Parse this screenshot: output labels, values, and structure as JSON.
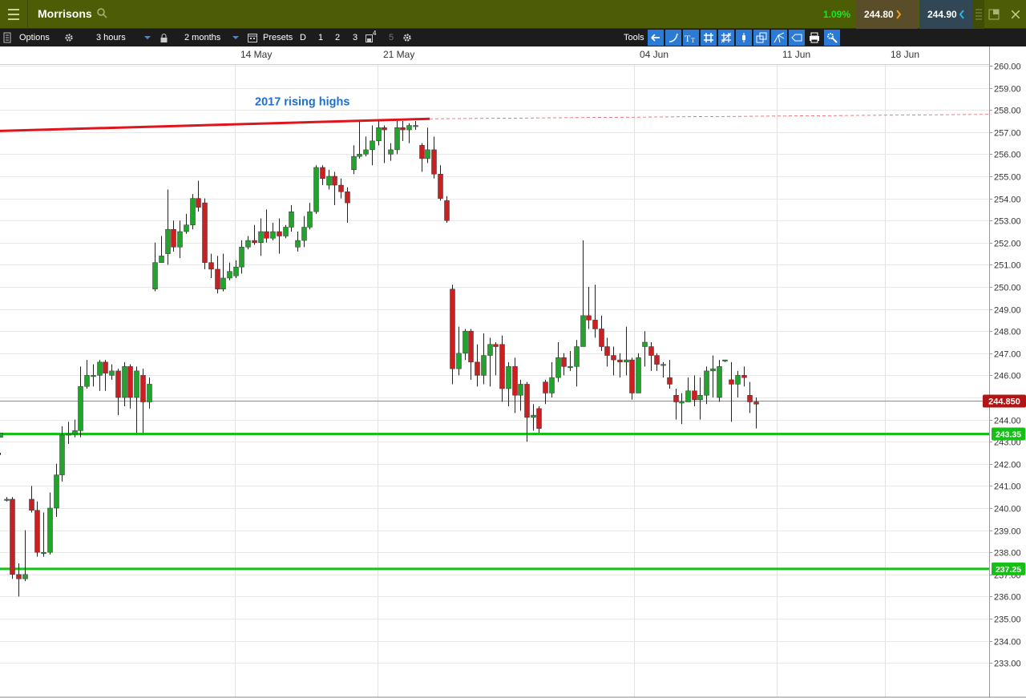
{
  "header": {
    "instrument": "Morrisons",
    "change_pct": "1.09%",
    "sell_price": "244.80",
    "buy_price": "244.90"
  },
  "toolbar": {
    "options_label": "Options",
    "interval": "3 hours",
    "range": "2 months",
    "presets_label": "Presets",
    "preset_items": [
      "D",
      "1",
      "2",
      "3",
      "4",
      "5"
    ],
    "tools_label": "Tools"
  },
  "colors": {
    "up": "#22a32b",
    "down": "#cc1f1f",
    "resistance": "#e0141c",
    "support": "#18bf18",
    "annotation": "#1e6fd1"
  },
  "chart_data": {
    "type": "candlestick",
    "x_ticks": [
      "14 May",
      "21 May",
      "04 Jun",
      "11 Jun",
      "18 Jun"
    ],
    "ylim": [
      232.5,
      260.3
    ],
    "y_ticks": [
      "260.00",
      "259.00",
      "258.00",
      "257.00",
      "256.00",
      "255.00",
      "254.00",
      "253.00",
      "252.00",
      "251.00",
      "250.00",
      "249.00",
      "248.00",
      "247.00",
      "246.00",
      "245.00",
      "244.00",
      "243.00",
      "242.00",
      "241.00",
      "240.00",
      "239.00",
      "238.00",
      "237.00",
      "236.00",
      "235.00",
      "234.00",
      "233.00"
    ],
    "current_price": "244.850",
    "support_levels": [
      {
        "label": "243.35",
        "value": 243.35
      },
      {
        "label": "237.25",
        "value": 237.25
      }
    ],
    "resistance_annotation": "2017 rising highs",
    "resistance_line": {
      "from": 257.05,
      "to": 257.6
    },
    "dashed_level": 257.8,
    "candles": [
      [
        243.2,
        243.4,
        242.5,
        242.4
      ],
      [
        240.4,
        240.4,
        240.5,
        240.3
      ],
      [
        240.4,
        237.0,
        240.5,
        236.8
      ],
      [
        237.0,
        236.8,
        237.5,
        236.0
      ],
      [
        236.8,
        237.0,
        239.0,
        236.7
      ],
      [
        240.4,
        239.9,
        241.0,
        239.8
      ],
      [
        239.9,
        238.0,
        240.3,
        237.8
      ],
      [
        238.0,
        238.0,
        239.8,
        237.8
      ],
      [
        238.0,
        240.0,
        240.7,
        237.9
      ],
      [
        240.0,
        241.5,
        242.0,
        239.6
      ],
      [
        241.5,
        243.3,
        243.7,
        241.2
      ],
      [
        243.3,
        243.35,
        243.9,
        242.9
      ],
      [
        243.35,
        243.5,
        244.0,
        243.2
      ],
      [
        243.5,
        245.5,
        246.4,
        243.2
      ],
      [
        245.5,
        246.0,
        246.7,
        245.4
      ],
      [
        246.0,
        246.0,
        246.5,
        245.5
      ],
      [
        246.0,
        246.6,
        246.7,
        245.3
      ],
      [
        246.6,
        246.1,
        246.7,
        245.3
      ],
      [
        246.0,
        246.2,
        246.5,
        245.8
      ],
      [
        246.2,
        245.0,
        246.3,
        244.2
      ],
      [
        245.0,
        246.4,
        246.6,
        244.6
      ],
      [
        246.4,
        245.0,
        246.5,
        244.5
      ],
      [
        245.0,
        246.2,
        246.4,
        243.4
      ],
      [
        246.0,
        244.8,
        246.3,
        243.4
      ],
      [
        244.8,
        245.6,
        245.9,
        244.5
      ],
      [
        249.9,
        251.1,
        252.0,
        249.8
      ],
      [
        251.1,
        251.4,
        252.3,
        251.3
      ],
      [
        251.5,
        252.6,
        254.4,
        251.0
      ],
      [
        252.6,
        251.8,
        253.0,
        251.6
      ],
      [
        251.8,
        252.5,
        253.0,
        251.3
      ],
      [
        252.5,
        252.8,
        253.3,
        252.4
      ],
      [
        252.8,
        254.0,
        254.2,
        252.6
      ],
      [
        254.0,
        253.6,
        254.8,
        253.4
      ],
      [
        253.8,
        251.1,
        254.0,
        250.8
      ],
      [
        251.1,
        250.8,
        251.5,
        250.4
      ],
      [
        250.8,
        249.9,
        251.4,
        249.7
      ],
      [
        249.9,
        250.4,
        251.5,
        249.8
      ],
      [
        250.4,
        250.7,
        251.1,
        250.3
      ],
      [
        250.5,
        250.9,
        251.2,
        250.4
      ],
      [
        250.9,
        251.8,
        252.1,
        250.6
      ],
      [
        251.8,
        252.1,
        252.3,
        251.7
      ],
      [
        252.1,
        252.0,
        252.8,
        251.9
      ],
      [
        252.0,
        252.5,
        253.1,
        251.4
      ],
      [
        252.5,
        252.2,
        253.5,
        252.0
      ],
      [
        252.2,
        252.5,
        252.9,
        252.1
      ],
      [
        252.5,
        252.3,
        253.1,
        251.5
      ],
      [
        252.3,
        252.7,
        252.8,
        252.2
      ],
      [
        252.7,
        253.4,
        253.7,
        252.5
      ],
      [
        251.8,
        252.1,
        252.5,
        251.6
      ],
      [
        252.1,
        252.7,
        253.2,
        251.8
      ],
      [
        252.7,
        253.4,
        253.8,
        252.6
      ],
      [
        253.4,
        255.4,
        255.5,
        253.3
      ],
      [
        255.4,
        254.9,
        255.5,
        254.6
      ],
      [
        254.6,
        255.0,
        255.3,
        254.4
      ],
      [
        255.0,
        254.6,
        255.2,
        253.7
      ],
      [
        254.6,
        254.3,
        254.9,
        254.0
      ],
      [
        254.3,
        253.8,
        254.5,
        252.9
      ],
      [
        255.3,
        255.9,
        256.4,
        255.1
      ],
      [
        255.9,
        256.0,
        257.5,
        255.8
      ],
      [
        256.0,
        256.2,
        256.8,
        255.9
      ],
      [
        256.2,
        256.6,
        257.3,
        255.5
      ],
      [
        256.6,
        257.2,
        257.5,
        256.4
      ],
      [
        257.2,
        257.1,
        257.3,
        255.6
      ],
      [
        256.0,
        256.2,
        256.5,
        255.7
      ],
      [
        256.2,
        257.2,
        257.5,
        256.0
      ],
      [
        257.2,
        257.1,
        257.5,
        256.6
      ],
      [
        257.1,
        257.3,
        257.4,
        256.5
      ],
      [
        257.3,
        257.3,
        257.5,
        257.1
      ],
      [
        256.4,
        255.8,
        256.5,
        255.2
      ],
      [
        255.8,
        256.2,
        257.2,
        255.6
      ],
      [
        256.2,
        255.1,
        256.8,
        254.9
      ],
      [
        255.1,
        254.0,
        255.5,
        253.9
      ],
      [
        253.9,
        253.0,
        254.1,
        252.9
      ],
      [
        249.9,
        246.3,
        250.1,
        245.6
      ],
      [
        246.3,
        247.0,
        248.2,
        246.0
      ],
      [
        247.0,
        248.0,
        248.1,
        246.7
      ],
      [
        248.0,
        246.6,
        248.1,
        245.8
      ],
      [
        246.6,
        246.0,
        247.4,
        245.5
      ],
      [
        246.0,
        246.9,
        247.9,
        245.6
      ],
      [
        246.9,
        247.4,
        247.7,
        245.5
      ],
      [
        247.4,
        247.3,
        247.5,
        246.0
      ],
      [
        247.4,
        245.4,
        247.8,
        244.8
      ],
      [
        245.4,
        246.4,
        246.6,
        244.6
      ],
      [
        246.4,
        245.1,
        246.8,
        244.3
      ],
      [
        245.1,
        245.6,
        245.8,
        244.4
      ],
      [
        245.6,
        244.1,
        245.7,
        243.0
      ],
      [
        244.1,
        244.2,
        244.7,
        243.5
      ],
      [
        244.5,
        243.6,
        244.6,
        243.4
      ],
      [
        245.7,
        245.2,
        245.8,
        244.7
      ],
      [
        245.2,
        245.9,
        246.6,
        245.0
      ],
      [
        245.9,
        246.8,
        247.5,
        245.7
      ],
      [
        246.8,
        246.4,
        247.0,
        246.0
      ],
      [
        246.4,
        246.4,
        247.1,
        246.2
      ],
      [
        246.4,
        247.3,
        247.6,
        245.5
      ],
      [
        247.3,
        248.7,
        252.1,
        248.1
      ],
      [
        248.7,
        248.5,
        250.0,
        248.1
      ],
      [
        248.5,
        248.1,
        250.1,
        247.7
      ],
      [
        248.1,
        247.3,
        248.7,
        247.1
      ],
      [
        247.3,
        246.9,
        247.7,
        246.4
      ],
      [
        246.9,
        246.7,
        247.3,
        246.0
      ],
      [
        246.7,
        246.6,
        247.0,
        245.9
      ],
      [
        246.6,
        246.7,
        248.2,
        246.0
      ],
      [
        246.7,
        245.2,
        246.8,
        244.9
      ],
      [
        245.2,
        246.8,
        247.0,
        245.3
      ],
      [
        247.3,
        247.5,
        248.0,
        246.4
      ],
      [
        247.3,
        246.9,
        247.5,
        246.2
      ],
      [
        246.9,
        246.5,
        247.0,
        246.2
      ],
      [
        246.5,
        246.5,
        246.6,
        245.9
      ],
      [
        245.9,
        245.6,
        246.7,
        245.4
      ],
      [
        245.1,
        244.8,
        245.4,
        244.0
      ],
      [
        244.8,
        244.8,
        245.2,
        243.8
      ],
      [
        244.8,
        245.3,
        245.9,
        244.8
      ],
      [
        245.3,
        244.9,
        246.0,
        244.6
      ],
      [
        244.9,
        245.1,
        245.9,
        244.0
      ],
      [
        245.1,
        246.2,
        246.4,
        244.7
      ],
      [
        246.2,
        246.3,
        246.9,
        245.0
      ],
      [
        245.0,
        246.4,
        246.7,
        244.8
      ],
      [
        246.7,
        246.7,
        246.7,
        246.6
      ],
      [
        245.8,
        245.6,
        246.6,
        243.9
      ],
      [
        245.6,
        246.0,
        246.2,
        245.0
      ],
      [
        246.0,
        245.9,
        246.4,
        245.5
      ],
      [
        245.1,
        244.8,
        245.7,
        244.3
      ],
      [
        244.8,
        244.7,
        245.0,
        243.6
      ]
    ]
  }
}
